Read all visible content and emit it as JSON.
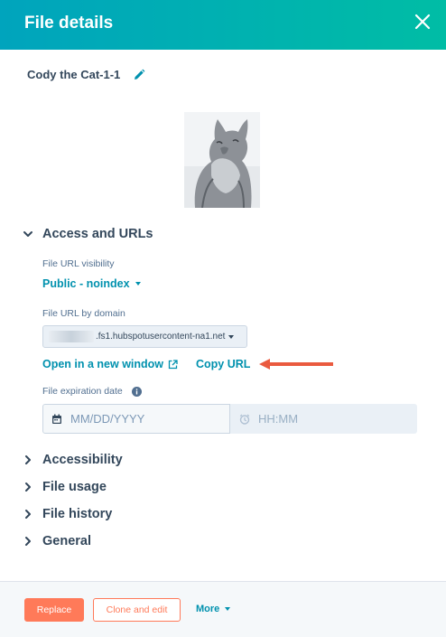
{
  "header": {
    "title": "File details"
  },
  "file": {
    "name": "Cody the Cat-1-1"
  },
  "sections": {
    "access": "Access and URLs",
    "accessibility": "Accessibility",
    "usage": "File usage",
    "history": "File history",
    "general": "General"
  },
  "access": {
    "visibility_label": "File URL visibility",
    "visibility_value": "Public - noindex",
    "domain_label": "File URL by domain",
    "domain_value": ".fs1.hubspotusercontent-na1.net",
    "open_link": "Open in a new window",
    "copy_link": "Copy URL",
    "expiration_label": "File expiration date",
    "date_placeholder": "MM/DD/YYYY",
    "time_placeholder": "HH:MM"
  },
  "footer": {
    "replace": "Replace",
    "clone": "Clone and edit",
    "more": "More"
  },
  "colors": {
    "header": "#00a4bd",
    "accent": "#0091ae",
    "primary": "#ff7a59",
    "arrow": "#ea5a3f"
  },
  "icons": [
    "close-icon",
    "pencil-icon",
    "chevron-down-icon",
    "chevron-right-icon",
    "external-link-icon",
    "info-icon",
    "calendar-icon",
    "clock-icon",
    "arrow-left-icon"
  ]
}
